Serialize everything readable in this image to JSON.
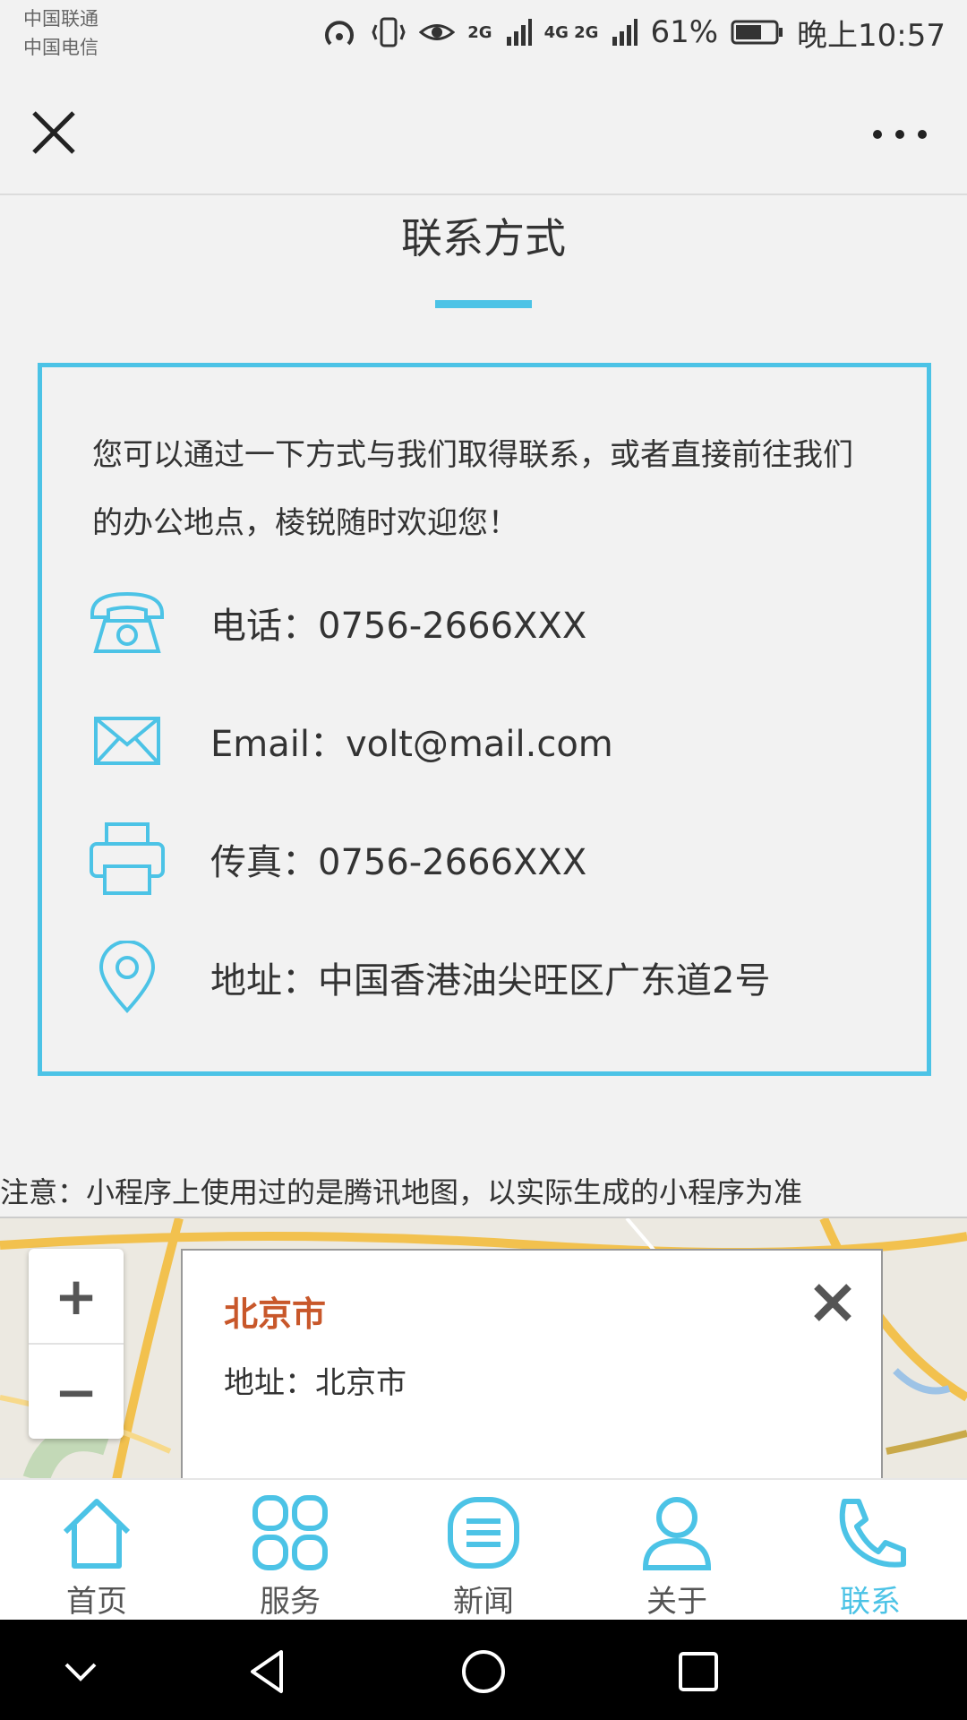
{
  "status_bar": {
    "carrier_1": "中国联通",
    "carrier_2": "中国电信",
    "battery": "61%",
    "time": "晚上10:57",
    "signal_1": "2G",
    "signal_2": "4G 2G"
  },
  "page": {
    "title": "联系方式",
    "accent_color": "#4cc3e6"
  },
  "contact": {
    "intro": "您可以通过一下方式与我们取得联系，或者直接前往我们的办公地点，棱锐随时欢迎您！",
    "items": [
      {
        "icon": "telephone-icon",
        "label": "电话：0756-2666XXX"
      },
      {
        "icon": "mail-icon",
        "label": "Email：volt@mail.com"
      },
      {
        "icon": "printer-icon",
        "label": "传真：0756-2666XXX"
      },
      {
        "icon": "location-pin-icon",
        "label": "地址：中国香港油尖旺区广东道2号"
      }
    ]
  },
  "notice": "注意：小程序上使用过的是腾讯地图，以实际生成的小程序为准",
  "map": {
    "zoom_in": "+",
    "zoom_out": "−",
    "popup_title": "北京市",
    "popup_address": "地址：北京市"
  },
  "tabbar": {
    "tabs": [
      {
        "label": "首页",
        "icon": "home-icon"
      },
      {
        "label": "服务",
        "icon": "grid-icon"
      },
      {
        "label": "新闻",
        "icon": "news-icon"
      },
      {
        "label": "关于",
        "icon": "person-icon"
      },
      {
        "label": "联系",
        "icon": "phone-icon",
        "active": true
      }
    ]
  }
}
